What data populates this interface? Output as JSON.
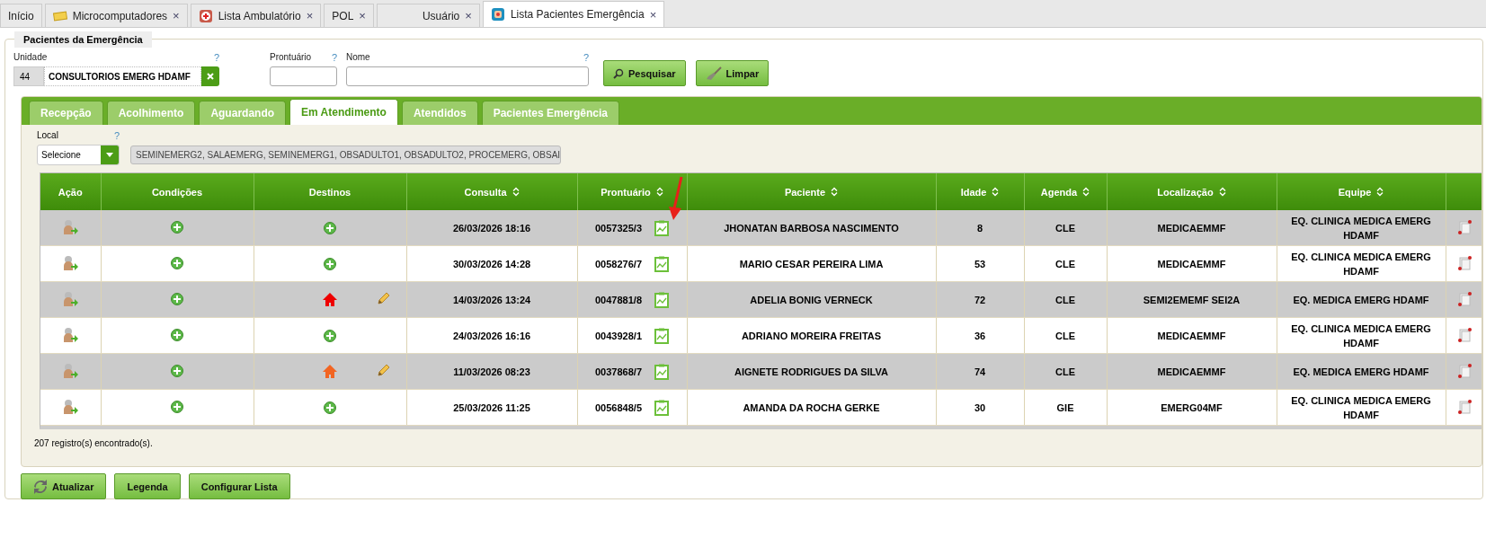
{
  "app_tabs": [
    {
      "label": "Início",
      "kind": "none",
      "closable": false,
      "selected": false
    },
    {
      "label": "Microcomputadores",
      "kind": "card",
      "closable": true,
      "selected": false
    },
    {
      "label": "Lista Ambulatório",
      "kind": "cross",
      "closable": true,
      "selected": false
    },
    {
      "label": "POL",
      "kind": "none",
      "closable": true,
      "selected": false
    },
    {
      "label": "Usuário",
      "kind": "blank",
      "closable": true,
      "selected": false
    },
    {
      "label": "Lista Pacientes Emergência",
      "kind": "badge",
      "closable": true,
      "selected": true
    }
  ],
  "close_glyph": "×",
  "panel": {
    "legend": "Pacientes da Emergência",
    "unidade": {
      "label": "Unidade",
      "help": "?",
      "code": "44",
      "value": "CONSULTORIOS EMERG HDAMF"
    },
    "prontuario": {
      "label": "Prontuário",
      "help": "?"
    },
    "nome": {
      "label": "Nome",
      "help": "?"
    },
    "buttons": [
      {
        "label": "Pesquisar",
        "kind": "search"
      },
      {
        "label": "Limpar",
        "kind": "broom"
      }
    ]
  },
  "tabs": [
    {
      "label": "Recepção",
      "selected": false
    },
    {
      "label": "Acolhimento",
      "selected": false
    },
    {
      "label": "Aguardando",
      "selected": false
    },
    {
      "label": "Em Atendimento",
      "selected": true
    },
    {
      "label": "Atendidos",
      "selected": false
    },
    {
      "label": "Pacientes Emergência",
      "selected": false
    }
  ],
  "local": {
    "label": "Local",
    "help": "?",
    "select": "Selecione",
    "value": "SEMINEMERG2, SALAEMERG, SEMINEMERG1, OBSADULTO1, OBSADULTO2, PROCEMERG, OBSAI"
  },
  "table": {
    "columns": [
      {
        "label": "Ação",
        "sortable": false
      },
      {
        "label": "Condições",
        "sortable": false
      },
      {
        "label": "Destinos",
        "sortable": false
      },
      {
        "label": "Consulta",
        "sortable": true
      },
      {
        "label": "Prontuário",
        "sortable": true
      },
      {
        "label": "Paciente",
        "sortable": true
      },
      {
        "label": "Idade",
        "sortable": true
      },
      {
        "label": "Agenda",
        "sortable": true
      },
      {
        "label": "Localização",
        "sortable": true
      },
      {
        "label": "Equipe",
        "sortable": true
      }
    ],
    "rows": [
      {
        "destino": {
          "kind": "add"
        },
        "consulta": "26/03/2026 18:16",
        "prontuario": "0057325/3",
        "paciente": "JHONATAN BARBOSA NASCIMENTO",
        "idade": "8",
        "agenda": "CLE",
        "localizacao": "MEDICAEMMF",
        "equipe": "EQ. CLINICA MEDICA EMERG HDAMF"
      },
      {
        "destino": {
          "kind": "add"
        },
        "consulta": "30/03/2026 14:28",
        "prontuario": "0058276/7",
        "paciente": "MARIO CESAR PEREIRA LIMA",
        "idade": "53",
        "agenda": "CLE",
        "localizacao": "MEDICAEMMF",
        "equipe": "EQ. CLINICA MEDICA EMERG HDAMF"
      },
      {
        "destino": {
          "kind": "home",
          "color": "#ee0000"
        },
        "consulta": "14/03/2026 13:24",
        "prontuario": "0047881/8",
        "paciente": "ADELIA BONIG VERNECK",
        "idade": "72",
        "agenda": "CLE",
        "localizacao": "SEMI2EMEMF SEI2A",
        "equipe": "EQ. MEDICA EMERG HDAMF"
      },
      {
        "destino": {
          "kind": "add"
        },
        "consulta": "24/03/2026 16:16",
        "prontuario": "0043928/1",
        "paciente": "ADRIANO MOREIRA FREITAS",
        "idade": "36",
        "agenda": "CLE",
        "localizacao": "MEDICAEMMF",
        "equipe": "EQ. CLINICA MEDICA EMERG HDAMF"
      },
      {
        "destino": {
          "kind": "home",
          "color": "#f26522"
        },
        "consulta": "11/03/2026 08:23",
        "prontuario": "0037868/7",
        "paciente": "AIGNETE RODRIGUES DA SILVA",
        "idade": "74",
        "agenda": "CLE",
        "localizacao": "MEDICAEMMF",
        "equipe": "EQ. MEDICA EMERG HDAMF"
      },
      {
        "destino": {
          "kind": "add"
        },
        "consulta": "25/03/2026 11:25",
        "prontuario": "0056848/5",
        "paciente": "AMANDA DA ROCHA GERKE",
        "idade": "30",
        "agenda": "GIE",
        "localizacao": "EMERG04MF",
        "equipe": "EQ. CLINICA MEDICA EMERG HDAMF"
      }
    ]
  },
  "count": "207 registro(s) encontrado(s).",
  "footer_buttons": [
    {
      "label": "Atualizar",
      "kind": "refresh"
    },
    {
      "label": "Legenda",
      "kind": "none"
    },
    {
      "label": "Configurar Lista",
      "kind": "none"
    }
  ]
}
